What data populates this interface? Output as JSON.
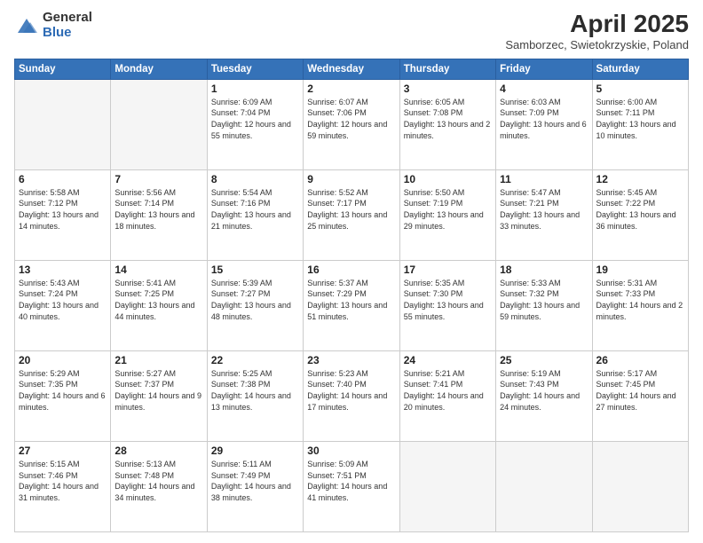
{
  "logo": {
    "general": "General",
    "blue": "Blue"
  },
  "title": "April 2025",
  "subtitle": "Samborzec, Swietokrzyskie, Poland",
  "headers": [
    "Sunday",
    "Monday",
    "Tuesday",
    "Wednesday",
    "Thursday",
    "Friday",
    "Saturday"
  ],
  "weeks": [
    [
      {
        "day": "",
        "sunrise": "",
        "sunset": "",
        "daylight": "",
        "empty": true
      },
      {
        "day": "",
        "sunrise": "",
        "sunset": "",
        "daylight": "",
        "empty": true
      },
      {
        "day": "1",
        "sunrise": "Sunrise: 6:09 AM",
        "sunset": "Sunset: 7:04 PM",
        "daylight": "Daylight: 12 hours and 55 minutes.",
        "empty": false
      },
      {
        "day": "2",
        "sunrise": "Sunrise: 6:07 AM",
        "sunset": "Sunset: 7:06 PM",
        "daylight": "Daylight: 12 hours and 59 minutes.",
        "empty": false
      },
      {
        "day": "3",
        "sunrise": "Sunrise: 6:05 AM",
        "sunset": "Sunset: 7:08 PM",
        "daylight": "Daylight: 13 hours and 2 minutes.",
        "empty": false
      },
      {
        "day": "4",
        "sunrise": "Sunrise: 6:03 AM",
        "sunset": "Sunset: 7:09 PM",
        "daylight": "Daylight: 13 hours and 6 minutes.",
        "empty": false
      },
      {
        "day": "5",
        "sunrise": "Sunrise: 6:00 AM",
        "sunset": "Sunset: 7:11 PM",
        "daylight": "Daylight: 13 hours and 10 minutes.",
        "empty": false
      }
    ],
    [
      {
        "day": "6",
        "sunrise": "Sunrise: 5:58 AM",
        "sunset": "Sunset: 7:12 PM",
        "daylight": "Daylight: 13 hours and 14 minutes.",
        "empty": false
      },
      {
        "day": "7",
        "sunrise": "Sunrise: 5:56 AM",
        "sunset": "Sunset: 7:14 PM",
        "daylight": "Daylight: 13 hours and 18 minutes.",
        "empty": false
      },
      {
        "day": "8",
        "sunrise": "Sunrise: 5:54 AM",
        "sunset": "Sunset: 7:16 PM",
        "daylight": "Daylight: 13 hours and 21 minutes.",
        "empty": false
      },
      {
        "day": "9",
        "sunrise": "Sunrise: 5:52 AM",
        "sunset": "Sunset: 7:17 PM",
        "daylight": "Daylight: 13 hours and 25 minutes.",
        "empty": false
      },
      {
        "day": "10",
        "sunrise": "Sunrise: 5:50 AM",
        "sunset": "Sunset: 7:19 PM",
        "daylight": "Daylight: 13 hours and 29 minutes.",
        "empty": false
      },
      {
        "day": "11",
        "sunrise": "Sunrise: 5:47 AM",
        "sunset": "Sunset: 7:21 PM",
        "daylight": "Daylight: 13 hours and 33 minutes.",
        "empty": false
      },
      {
        "day": "12",
        "sunrise": "Sunrise: 5:45 AM",
        "sunset": "Sunset: 7:22 PM",
        "daylight": "Daylight: 13 hours and 36 minutes.",
        "empty": false
      }
    ],
    [
      {
        "day": "13",
        "sunrise": "Sunrise: 5:43 AM",
        "sunset": "Sunset: 7:24 PM",
        "daylight": "Daylight: 13 hours and 40 minutes.",
        "empty": false
      },
      {
        "day": "14",
        "sunrise": "Sunrise: 5:41 AM",
        "sunset": "Sunset: 7:25 PM",
        "daylight": "Daylight: 13 hours and 44 minutes.",
        "empty": false
      },
      {
        "day": "15",
        "sunrise": "Sunrise: 5:39 AM",
        "sunset": "Sunset: 7:27 PM",
        "daylight": "Daylight: 13 hours and 48 minutes.",
        "empty": false
      },
      {
        "day": "16",
        "sunrise": "Sunrise: 5:37 AM",
        "sunset": "Sunset: 7:29 PM",
        "daylight": "Daylight: 13 hours and 51 minutes.",
        "empty": false
      },
      {
        "day": "17",
        "sunrise": "Sunrise: 5:35 AM",
        "sunset": "Sunset: 7:30 PM",
        "daylight": "Daylight: 13 hours and 55 minutes.",
        "empty": false
      },
      {
        "day": "18",
        "sunrise": "Sunrise: 5:33 AM",
        "sunset": "Sunset: 7:32 PM",
        "daylight": "Daylight: 13 hours and 59 minutes.",
        "empty": false
      },
      {
        "day": "19",
        "sunrise": "Sunrise: 5:31 AM",
        "sunset": "Sunset: 7:33 PM",
        "daylight": "Daylight: 14 hours and 2 minutes.",
        "empty": false
      }
    ],
    [
      {
        "day": "20",
        "sunrise": "Sunrise: 5:29 AM",
        "sunset": "Sunset: 7:35 PM",
        "daylight": "Daylight: 14 hours and 6 minutes.",
        "empty": false
      },
      {
        "day": "21",
        "sunrise": "Sunrise: 5:27 AM",
        "sunset": "Sunset: 7:37 PM",
        "daylight": "Daylight: 14 hours and 9 minutes.",
        "empty": false
      },
      {
        "day": "22",
        "sunrise": "Sunrise: 5:25 AM",
        "sunset": "Sunset: 7:38 PM",
        "daylight": "Daylight: 14 hours and 13 minutes.",
        "empty": false
      },
      {
        "day": "23",
        "sunrise": "Sunrise: 5:23 AM",
        "sunset": "Sunset: 7:40 PM",
        "daylight": "Daylight: 14 hours and 17 minutes.",
        "empty": false
      },
      {
        "day": "24",
        "sunrise": "Sunrise: 5:21 AM",
        "sunset": "Sunset: 7:41 PM",
        "daylight": "Daylight: 14 hours and 20 minutes.",
        "empty": false
      },
      {
        "day": "25",
        "sunrise": "Sunrise: 5:19 AM",
        "sunset": "Sunset: 7:43 PM",
        "daylight": "Daylight: 14 hours and 24 minutes.",
        "empty": false
      },
      {
        "day": "26",
        "sunrise": "Sunrise: 5:17 AM",
        "sunset": "Sunset: 7:45 PM",
        "daylight": "Daylight: 14 hours and 27 minutes.",
        "empty": false
      }
    ],
    [
      {
        "day": "27",
        "sunrise": "Sunrise: 5:15 AM",
        "sunset": "Sunset: 7:46 PM",
        "daylight": "Daylight: 14 hours and 31 minutes.",
        "empty": false
      },
      {
        "day": "28",
        "sunrise": "Sunrise: 5:13 AM",
        "sunset": "Sunset: 7:48 PM",
        "daylight": "Daylight: 14 hours and 34 minutes.",
        "empty": false
      },
      {
        "day": "29",
        "sunrise": "Sunrise: 5:11 AM",
        "sunset": "Sunset: 7:49 PM",
        "daylight": "Daylight: 14 hours and 38 minutes.",
        "empty": false
      },
      {
        "day": "30",
        "sunrise": "Sunrise: 5:09 AM",
        "sunset": "Sunset: 7:51 PM",
        "daylight": "Daylight: 14 hours and 41 minutes.",
        "empty": false
      },
      {
        "day": "",
        "sunrise": "",
        "sunset": "",
        "daylight": "",
        "empty": true
      },
      {
        "day": "",
        "sunrise": "",
        "sunset": "",
        "daylight": "",
        "empty": true
      },
      {
        "day": "",
        "sunrise": "",
        "sunset": "",
        "daylight": "",
        "empty": true
      }
    ]
  ]
}
